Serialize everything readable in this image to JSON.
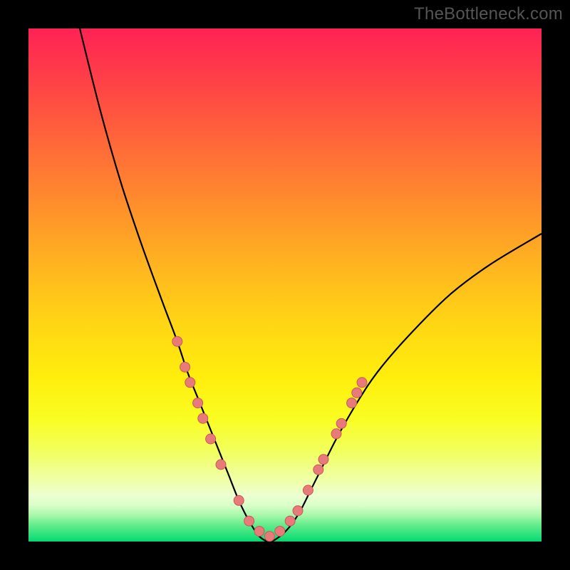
{
  "watermark": "TheBottleneck.com",
  "colors": {
    "frame": "#000000",
    "gradient_top": "#ff2255",
    "gradient_bottom": "#00d870",
    "curve": "#000000",
    "dot_fill": "#e87a7a",
    "dot_stroke": "#c85a5a"
  },
  "chart_data": {
    "type": "line",
    "title": "",
    "xlabel": "",
    "ylabel": "",
    "xlim": [
      0,
      100
    ],
    "ylim": [
      0,
      100
    ],
    "notes": "Background is a vertical rainbow gradient (red top → green bottom). Curve is a V-shaped bottleneck profile with minimum ≈0 around x≈41–49. Left branch starts near (10,100); right branch ends near (100,60). Pink dots mark sampled points on both descending and ascending branches near the trough.",
    "series": [
      {
        "name": "bottleneck-curve",
        "x": [
          10,
          14,
          18,
          22,
          26,
          29,
          31,
          33,
          35,
          37,
          39,
          41,
          43,
          45,
          47,
          49,
          51,
          53,
          55,
          57,
          60,
          64,
          68,
          74,
          82,
          90,
          100
        ],
        "y": [
          100,
          84,
          70,
          58,
          47,
          39,
          33,
          28,
          23,
          18,
          13,
          8,
          4,
          1,
          0,
          1,
          3,
          6,
          10,
          14,
          20,
          27,
          33,
          40,
          48,
          54,
          60
        ]
      }
    ],
    "dots": [
      {
        "x": 29.0,
        "y": 39
      },
      {
        "x": 30.5,
        "y": 34
      },
      {
        "x": 31.5,
        "y": 31
      },
      {
        "x": 33.0,
        "y": 27
      },
      {
        "x": 34.0,
        "y": 24
      },
      {
        "x": 35.5,
        "y": 20
      },
      {
        "x": 37.5,
        "y": 15
      },
      {
        "x": 41.0,
        "y": 8
      },
      {
        "x": 43.0,
        "y": 4
      },
      {
        "x": 45.0,
        "y": 2
      },
      {
        "x": 47.0,
        "y": 1
      },
      {
        "x": 49.0,
        "y": 2
      },
      {
        "x": 51.0,
        "y": 4
      },
      {
        "x": 52.5,
        "y": 6
      },
      {
        "x": 54.5,
        "y": 10
      },
      {
        "x": 56.5,
        "y": 14
      },
      {
        "x": 57.5,
        "y": 16
      },
      {
        "x": 60.0,
        "y": 21
      },
      {
        "x": 61.0,
        "y": 23
      },
      {
        "x": 63.0,
        "y": 27
      },
      {
        "x": 64.0,
        "y": 29
      },
      {
        "x": 65.0,
        "y": 31
      }
    ]
  }
}
